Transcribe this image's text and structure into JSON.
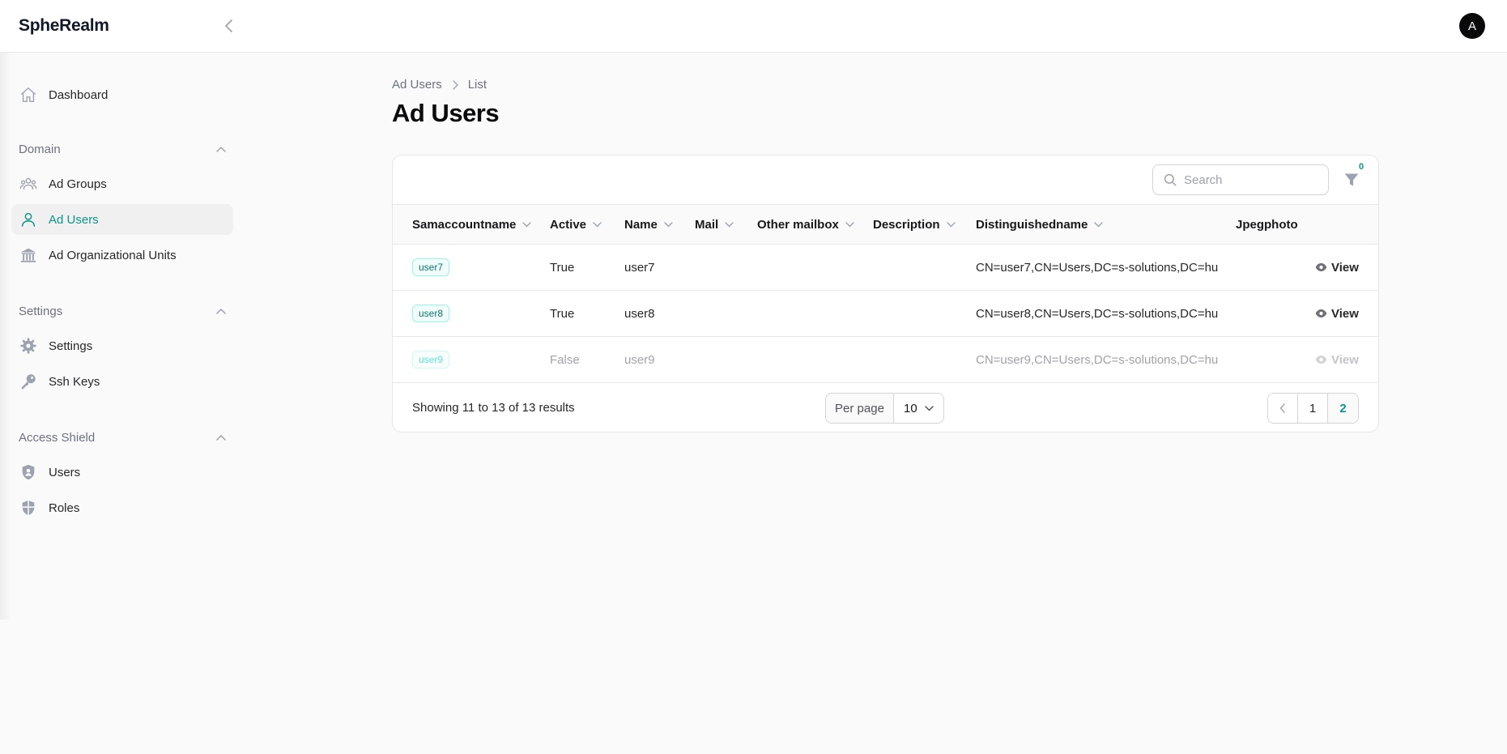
{
  "app": {
    "brand": "SpheRealm",
    "avatar_initial": "A"
  },
  "colors": {
    "accent": "#0d9488",
    "active_nav_bg": "#f0f0f1"
  },
  "sidebar": {
    "dashboard": {
      "label": "Dashboard",
      "icon": "home-icon"
    },
    "groups": [
      {
        "title": "Domain",
        "items": [
          {
            "label": "Ad Groups",
            "icon": "user-group-icon"
          },
          {
            "label": "Ad Users",
            "icon": "user-icon",
            "active": true
          },
          {
            "label": "Ad Organizational Units",
            "icon": "building-library-icon"
          }
        ]
      },
      {
        "title": "Settings",
        "items": [
          {
            "label": "Settings",
            "icon": "cog-icon"
          },
          {
            "label": "Ssh Keys",
            "icon": "key-icon"
          }
        ]
      },
      {
        "title": "Access Shield",
        "items": [
          {
            "label": "Users",
            "icon": "shield-user-icon"
          },
          {
            "label": "Roles",
            "icon": "shield-icon"
          }
        ]
      }
    ]
  },
  "breadcrumb": {
    "parent": "Ad Users",
    "current": "List"
  },
  "page": {
    "title": "Ad Users"
  },
  "toolbar": {
    "search_placeholder": "Search",
    "search_value": "",
    "filter_count": "0"
  },
  "table": {
    "columns": [
      "Samaccountname",
      "Active",
      "Name",
      "Mail",
      "Other mailbox",
      "Description",
      "Distinguishedname",
      "Jpegphoto"
    ],
    "rows": [
      {
        "samaccountname": "user7",
        "active": "True",
        "name": "user7",
        "mail": "",
        "other_mailbox": "",
        "description": "",
        "dn": "CN=user7,CN=Users,DC=s-solutions,DC=hu",
        "action": "View",
        "dimmed": false
      },
      {
        "samaccountname": "user8",
        "active": "True",
        "name": "user8",
        "mail": "",
        "other_mailbox": "",
        "description": "",
        "dn": "CN=user8,CN=Users,DC=s-solutions,DC=hu",
        "action": "View",
        "dimmed": false
      },
      {
        "samaccountname": "user9",
        "active": "False",
        "name": "user9",
        "mail": "",
        "other_mailbox": "",
        "description": "",
        "dn": "CN=user9,CN=Users,DC=s-solutions,DC=hu",
        "action": "View",
        "dimmed": true
      }
    ]
  },
  "footer": {
    "results": "Showing 11 to 13 of 13 results",
    "per_page_label": "Per page",
    "per_page_value": "10",
    "pages": [
      "1",
      "2"
    ],
    "current_page": "2"
  }
}
